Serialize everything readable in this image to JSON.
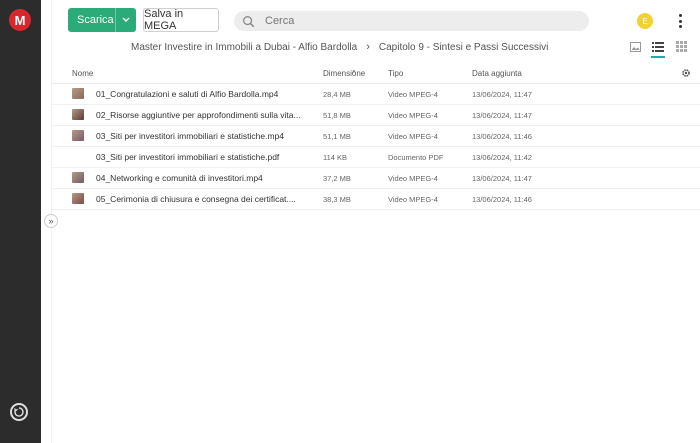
{
  "sidebar": {
    "logo_text": "M",
    "logo_color": "#d9272e",
    "bottom_icon": "sync-icon"
  },
  "toolbar": {
    "download_label": "Scarica",
    "save_label": "Salva in MEGA",
    "accent_color": "#2bab78"
  },
  "search": {
    "placeholder": "Cerca",
    "value": ""
  },
  "user": {
    "avatar_letter": "E",
    "avatar_color": "#f2d22c"
  },
  "breadcrumb": [
    "Master Investire in Immobili a Dubai - Alfio Bardolla",
    "Capitolo 9 - Sintesi e Passi Successivi"
  ],
  "view_modes": [
    "thumbnail-view-icon",
    "list-view-icon",
    "grid-view-icon"
  ],
  "table": {
    "columns": {
      "name": "Nome",
      "size": "Dimensione",
      "type": "Tipo",
      "date": "Data aggiunta"
    },
    "rows": [
      {
        "name": "01_Congratulazioni e saluti di Alfio Bardolla.mp4",
        "size": "28,4 MB",
        "type": "Video MPEG-4",
        "date": "13/06/2024, 11:47",
        "thumb": "video"
      },
      {
        "name": "02_Risorse aggiuntive per approfondimenti sulla vita...",
        "size": "51,8 MB",
        "type": "Video MPEG-4",
        "date": "13/06/2024, 11:47",
        "thumb": "video"
      },
      {
        "name": "03_Siti per investitori immobiliari e statistiche.mp4",
        "size": "51,1 MB",
        "type": "Video MPEG-4",
        "date": "13/06/2024, 11:46",
        "thumb": "video"
      },
      {
        "name": "03_Siti per investitori immobiliari e statistiche.pdf",
        "size": "114 KB",
        "type": "Documento PDF",
        "date": "13/06/2024, 11:42",
        "thumb": "none"
      },
      {
        "name": "04_Networking e comunità di investitori.mp4",
        "size": "37,2 MB",
        "type": "Video MPEG-4",
        "date": "13/06/2024, 11:47",
        "thumb": "video"
      },
      {
        "name": "05_Cerimonia di chiusura e consegna dei certificat....",
        "size": "38,3 MB",
        "type": "Video MPEG-4",
        "date": "13/06/2024, 11:46",
        "thumb": "video"
      }
    ]
  }
}
